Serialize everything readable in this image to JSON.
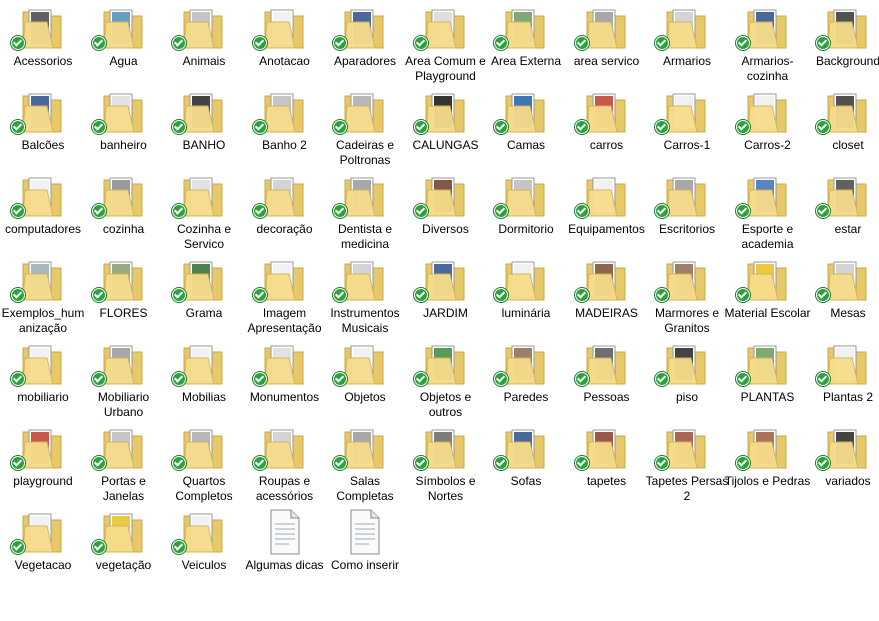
{
  "items": [
    {
      "label": "Acessorios",
      "type": "folder",
      "thumb": "#444"
    },
    {
      "label": "Agua",
      "type": "folder",
      "thumb": "#4a8fb8"
    },
    {
      "label": "Animais",
      "type": "folder",
      "thumb": "#bbb"
    },
    {
      "label": "Anotacao",
      "type": "folder",
      "thumb": "#eee"
    },
    {
      "label": "Aparadores",
      "type": "folder",
      "thumb": "#2a4d8a"
    },
    {
      "label": "Area Comum e Playground",
      "type": "folder",
      "thumb": "#d8d8d8"
    },
    {
      "label": "Area Externa",
      "type": "folder",
      "thumb": "#6d9a5a"
    },
    {
      "label": "area servico",
      "type": "folder",
      "thumb": "#999"
    },
    {
      "label": "Armarios",
      "type": "folder",
      "thumb": "#ccc"
    },
    {
      "label": "Armarios-cozinha",
      "type": "folder",
      "thumb": "#2a4d8a"
    },
    {
      "label": "Background",
      "type": "folder",
      "thumb": "#333"
    },
    {
      "label": "Balcões",
      "type": "folder",
      "thumb": "#2a4d8a"
    },
    {
      "label": "banheiro",
      "type": "folder",
      "thumb": "#ddd"
    },
    {
      "label": "BANHO",
      "type": "folder",
      "thumb": "#222"
    },
    {
      "label": "Banho 2",
      "type": "folder",
      "thumb": "#bbb"
    },
    {
      "label": "Cadeiras e Poltronas",
      "type": "folder",
      "thumb": "#aaa"
    },
    {
      "label": "CALUNGAS",
      "type": "folder",
      "thumb": "#111"
    },
    {
      "label": "Camas",
      "type": "folder",
      "thumb": "#1f5ea8"
    },
    {
      "label": "carros",
      "type": "folder",
      "thumb": "#c0392b"
    },
    {
      "label": "Carros-1",
      "type": "folder",
      "thumb": "#eee"
    },
    {
      "label": "Carros-2",
      "type": "folder",
      "thumb": "#eee"
    },
    {
      "label": "closet",
      "type": "folder",
      "thumb": "#333"
    },
    {
      "label": "computadores",
      "type": "folder",
      "thumb": "#eee"
    },
    {
      "label": "cozinha",
      "type": "folder",
      "thumb": "#888"
    },
    {
      "label": "Cozinha e Servico",
      "type": "folder",
      "thumb": "#ddd"
    },
    {
      "label": "decoração",
      "type": "folder",
      "thumb": "#ccc"
    },
    {
      "label": "Dentista e medicina",
      "type": "folder",
      "thumb": "#999"
    },
    {
      "label": "Diversos",
      "type": "folder",
      "thumb": "#6b3a2a"
    },
    {
      "label": "Dormitorio",
      "type": "folder",
      "thumb": "#bbb"
    },
    {
      "label": "Equipamentos",
      "type": "folder",
      "thumb": "#eee"
    },
    {
      "label": "Escritorios",
      "type": "folder",
      "thumb": "#999"
    },
    {
      "label": "Esporte e academia",
      "type": "folder",
      "thumb": "#3b6fb5"
    },
    {
      "label": "estar",
      "type": "folder",
      "thumb": "#444"
    },
    {
      "label": "Exemplos_humanização",
      "type": "folder",
      "thumb": "#9aa"
    },
    {
      "label": "FLORES",
      "type": "folder",
      "thumb": "#8a9a6a"
    },
    {
      "label": "Grama",
      "type": "folder",
      "thumb": "#2e6b2e"
    },
    {
      "label": "Imagem Apresentação",
      "type": "folder",
      "thumb": "#eee"
    },
    {
      "label": "Instrumentos Musicais",
      "type": "folder",
      "thumb": "#ccc"
    },
    {
      "label": "JARDIM",
      "type": "folder",
      "thumb": "#2a4d8a"
    },
    {
      "label": "luminária",
      "type": "folder",
      "thumb": "#eee"
    },
    {
      "label": "MADEIRAS",
      "type": "folder",
      "thumb": "#7a4a2a"
    },
    {
      "label": "Marmores e Granitos",
      "type": "folder",
      "thumb": "#8a6a4a"
    },
    {
      "label": "Material Escolar",
      "type": "folder",
      "thumb": "#e6c020"
    },
    {
      "label": "Mesas",
      "type": "folder",
      "thumb": "#ccc"
    },
    {
      "label": "mobiliario",
      "type": "folder",
      "thumb": "#eee"
    },
    {
      "label": "Mobiliario Urbano",
      "type": "folder",
      "thumb": "#999"
    },
    {
      "label": "Mobilias",
      "type": "folder",
      "thumb": "#eee"
    },
    {
      "label": "Monumentos",
      "type": "folder",
      "thumb": "#ddd"
    },
    {
      "label": "Objetos",
      "type": "folder",
      "thumb": "#eee"
    },
    {
      "label": "Objetos e outros",
      "type": "folder",
      "thumb": "#3a8a3a"
    },
    {
      "label": "Paredes",
      "type": "folder",
      "thumb": "#8a6a4a"
    },
    {
      "label": "Pessoas",
      "type": "folder",
      "thumb": "#555"
    },
    {
      "label": "piso",
      "type": "folder",
      "thumb": "#222"
    },
    {
      "label": "PLANTAS",
      "type": "folder",
      "thumb": "#6a9a5a"
    },
    {
      "label": "Plantas 2",
      "type": "folder",
      "thumb": "#eee"
    },
    {
      "label": "playground",
      "type": "folder",
      "thumb": "#c0392b"
    },
    {
      "label": "Portas e Janelas",
      "type": "folder",
      "thumb": "#bbb"
    },
    {
      "label": "Quartos Completos",
      "type": "folder",
      "thumb": "#aaa"
    },
    {
      "label": "Roupas e acessórios",
      "type": "folder",
      "thumb": "#ccc"
    },
    {
      "label": "Salas Completas",
      "type": "folder",
      "thumb": "#999"
    },
    {
      "label": "Símbolos e Nortes",
      "type": "folder",
      "thumb": "#666"
    },
    {
      "label": "Sofas",
      "type": "folder",
      "thumb": "#2a4d8a"
    },
    {
      "label": "tapetes",
      "type": "folder",
      "thumb": "#8a3a2a"
    },
    {
      "label": "Tapetes Persas 2",
      "type": "folder",
      "thumb": "#a04a3a"
    },
    {
      "label": "Tijolos e Pedras",
      "type": "folder",
      "thumb": "#9a5a3a"
    },
    {
      "label": "variados",
      "type": "folder",
      "thumb": "#222"
    },
    {
      "label": "Vegetacao",
      "type": "folder",
      "thumb": "#eee"
    },
    {
      "label": "vegetação",
      "type": "folder",
      "thumb": "#e8c020"
    },
    {
      "label": "Veiculos",
      "type": "folder",
      "thumb": "#eee"
    },
    {
      "label": "Algumas dicas",
      "type": "file",
      "thumb": "#ffffff"
    },
    {
      "label": "Como inserir",
      "type": "file",
      "thumb": "#ffffff"
    }
  ]
}
